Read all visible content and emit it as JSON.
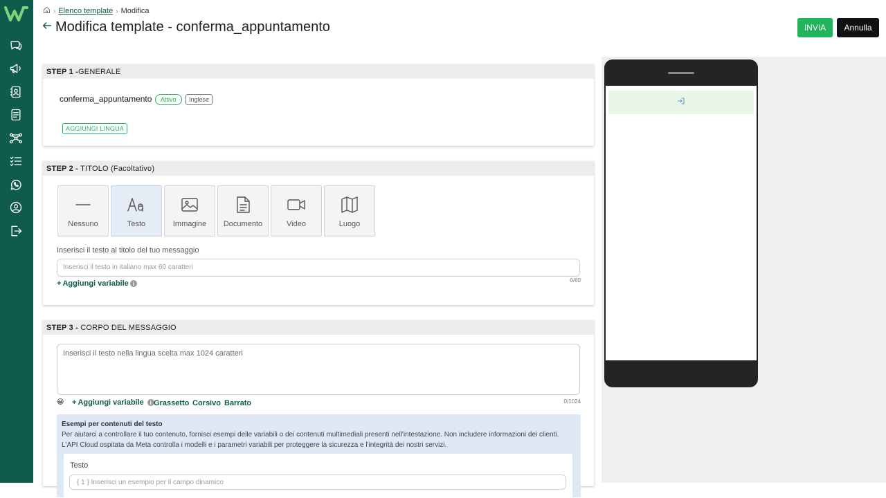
{
  "breadcrumb": {
    "parent": "Elenco template",
    "current": "Modifica",
    "separator": "›"
  },
  "header": {
    "title": "Modifica template - conferma_appuntamento"
  },
  "actions": {
    "send_label": "INVIA",
    "cancel_label": "Annulla"
  },
  "step1": {
    "header_bold": "STEP 1 -",
    "header_rest": "GENERALE",
    "template_name": "conferma_appuntamento",
    "status_badge": "Attivo",
    "language_badge": "Inglese",
    "add_language_label": "AGGIUNGI LINGUA"
  },
  "step2": {
    "header_bold": "STEP 2 -",
    "header_rest": " TITOLO (Facoltativo)",
    "types": [
      {
        "label": "Nessuno",
        "icon": "minus-icon"
      },
      {
        "label": "Testo",
        "icon": "text-aa-icon",
        "selected": true
      },
      {
        "label": "Immagine",
        "icon": "image-icon"
      },
      {
        "label": "Documento",
        "icon": "document-icon"
      },
      {
        "label": "Video",
        "icon": "video-icon"
      },
      {
        "label": "Luogo",
        "icon": "map-icon"
      }
    ],
    "field_label": "Inserisci il testo al titolo del tuo messaggio",
    "input_placeholder": "Inserisci il testo in italiano max 60 caratteri",
    "counter": "0/60",
    "add_variable_label": "Aggiungi variabile",
    "plus": "+",
    "info": "i"
  },
  "step3": {
    "header_bold": "STEP 3 -",
    "header_rest": " CORPO DEL MESSAGGIO",
    "textarea_placeholder": "Inserisci il testo nella lingua scelta max 1024 caratteri",
    "counter": "0/1024",
    "emoji": "😀",
    "plus": "+",
    "info": "i",
    "add_variable_label": "Aggiungi variabile",
    "format": {
      "bold": "Grassetto",
      "italic": "Corsivo",
      "strike": "Barrato"
    },
    "examples": {
      "title": "Esempi per contenuti del testo",
      "description": "Per aiutarci a controllare il tuo contenuto, fornisci esempi delle variabili o dei contenuti multimediali presenti nell'intestazione. Non includere informazioni dei clienti. L'API Cloud ospitata da Meta controlla i modelli e i parametri variabili per proteggere la sicurezza e l'integrità dei nostri servizi.",
      "field_label": "Testo",
      "field_placeholder": "{ 1 } Inserisci un esempio per il campo dinamico"
    }
  },
  "colors": {
    "sidebar": "#0f5c4c",
    "accent_green": "#22b35e",
    "link": "#0f5c4c"
  }
}
